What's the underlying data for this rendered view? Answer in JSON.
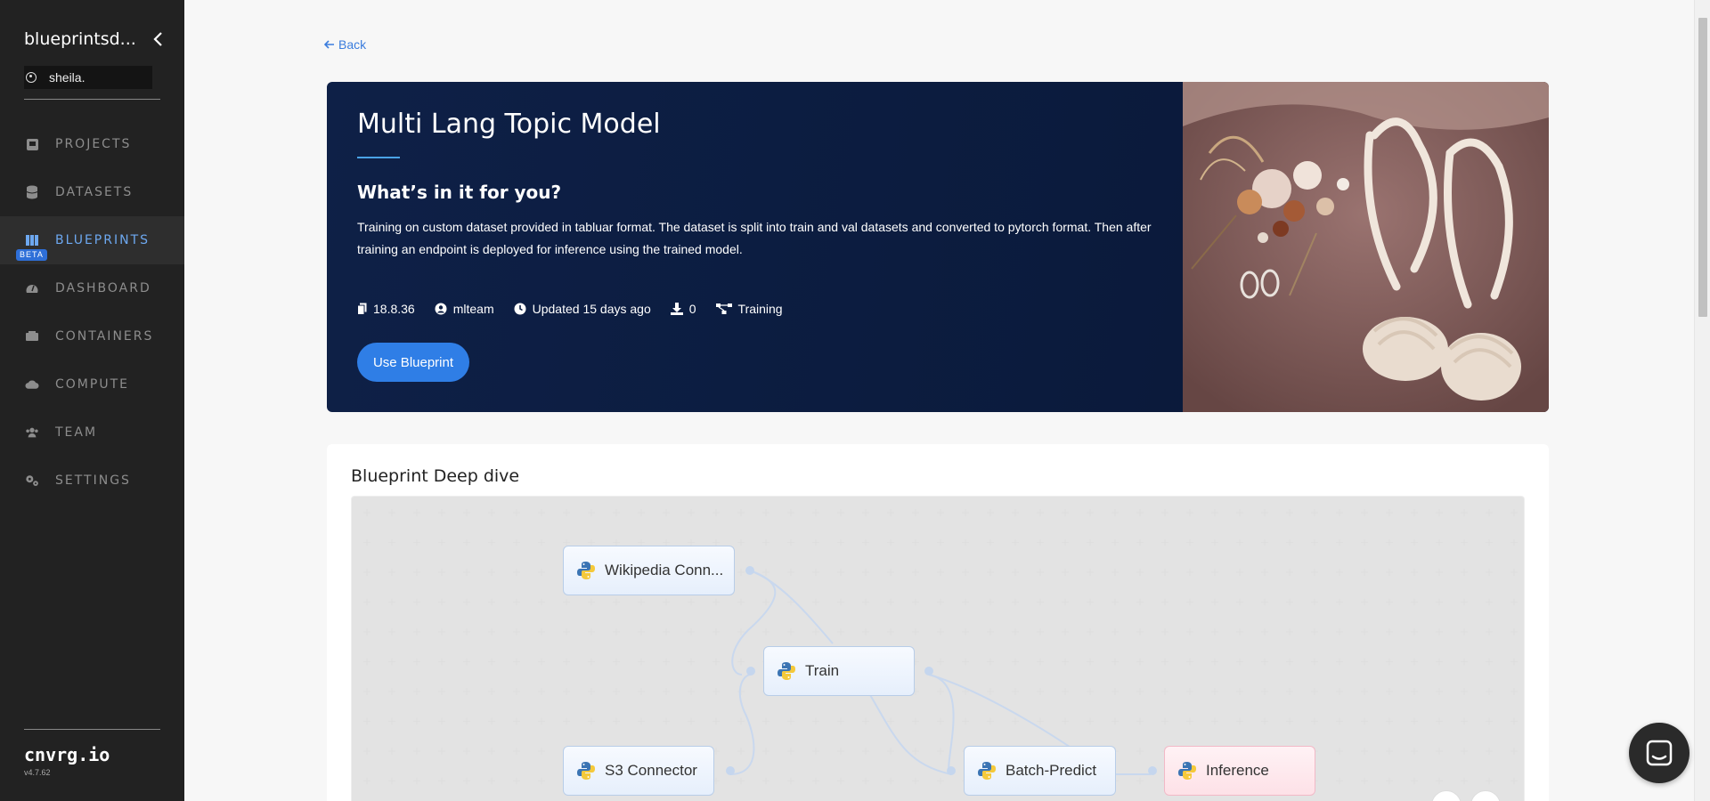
{
  "sidebar": {
    "workspace_name": "blueprintsd...",
    "user": "sheila.",
    "nav": [
      {
        "label": "PROJECTS",
        "icon": "projects-icon"
      },
      {
        "label": "DATASETS",
        "icon": "datasets-icon"
      },
      {
        "label": "BLUEPRINTS",
        "icon": "blueprints-icon",
        "active": true,
        "badge": "BETA"
      },
      {
        "label": "DASHBOARD",
        "icon": "dashboard-icon"
      },
      {
        "label": "CONTAINERS",
        "icon": "containers-icon"
      },
      {
        "label": "COMPUTE",
        "icon": "compute-icon"
      },
      {
        "label": "TEAM",
        "icon": "team-icon"
      },
      {
        "label": "SETTINGS",
        "icon": "settings-icon"
      }
    ],
    "brand": "cnvrg.io",
    "version": "v4.7.62"
  },
  "back_label": "Back",
  "hero": {
    "title": "Multi Lang Topic Model",
    "subtitle": "What’s in it for you?",
    "description": "Training on custom dataset provided in tabluar format. The dataset is split into train and val datasets and converted to pytorch format. Then after training an endpoint is deployed for inference using the trained model.",
    "meta": {
      "version": "18.8.36",
      "owner": "mlteam",
      "updated": "Updated 15 days ago",
      "downloads": "0",
      "type": "Training"
    },
    "button_label": "Use Blueprint"
  },
  "deep_dive": {
    "title": "Blueprint Deep dive",
    "nodes": [
      {
        "label": "Wikipedia Conn..."
      },
      {
        "label": "Train"
      },
      {
        "label": "S3 Connector"
      },
      {
        "label": "Batch-Predict"
      },
      {
        "label": "Inference"
      }
    ]
  },
  "colors": {
    "sidebar_bg": "#222222",
    "accent": "#2f7ee6",
    "hero_bg": "#0e2047",
    "active_nav": "#6da8f0"
  }
}
